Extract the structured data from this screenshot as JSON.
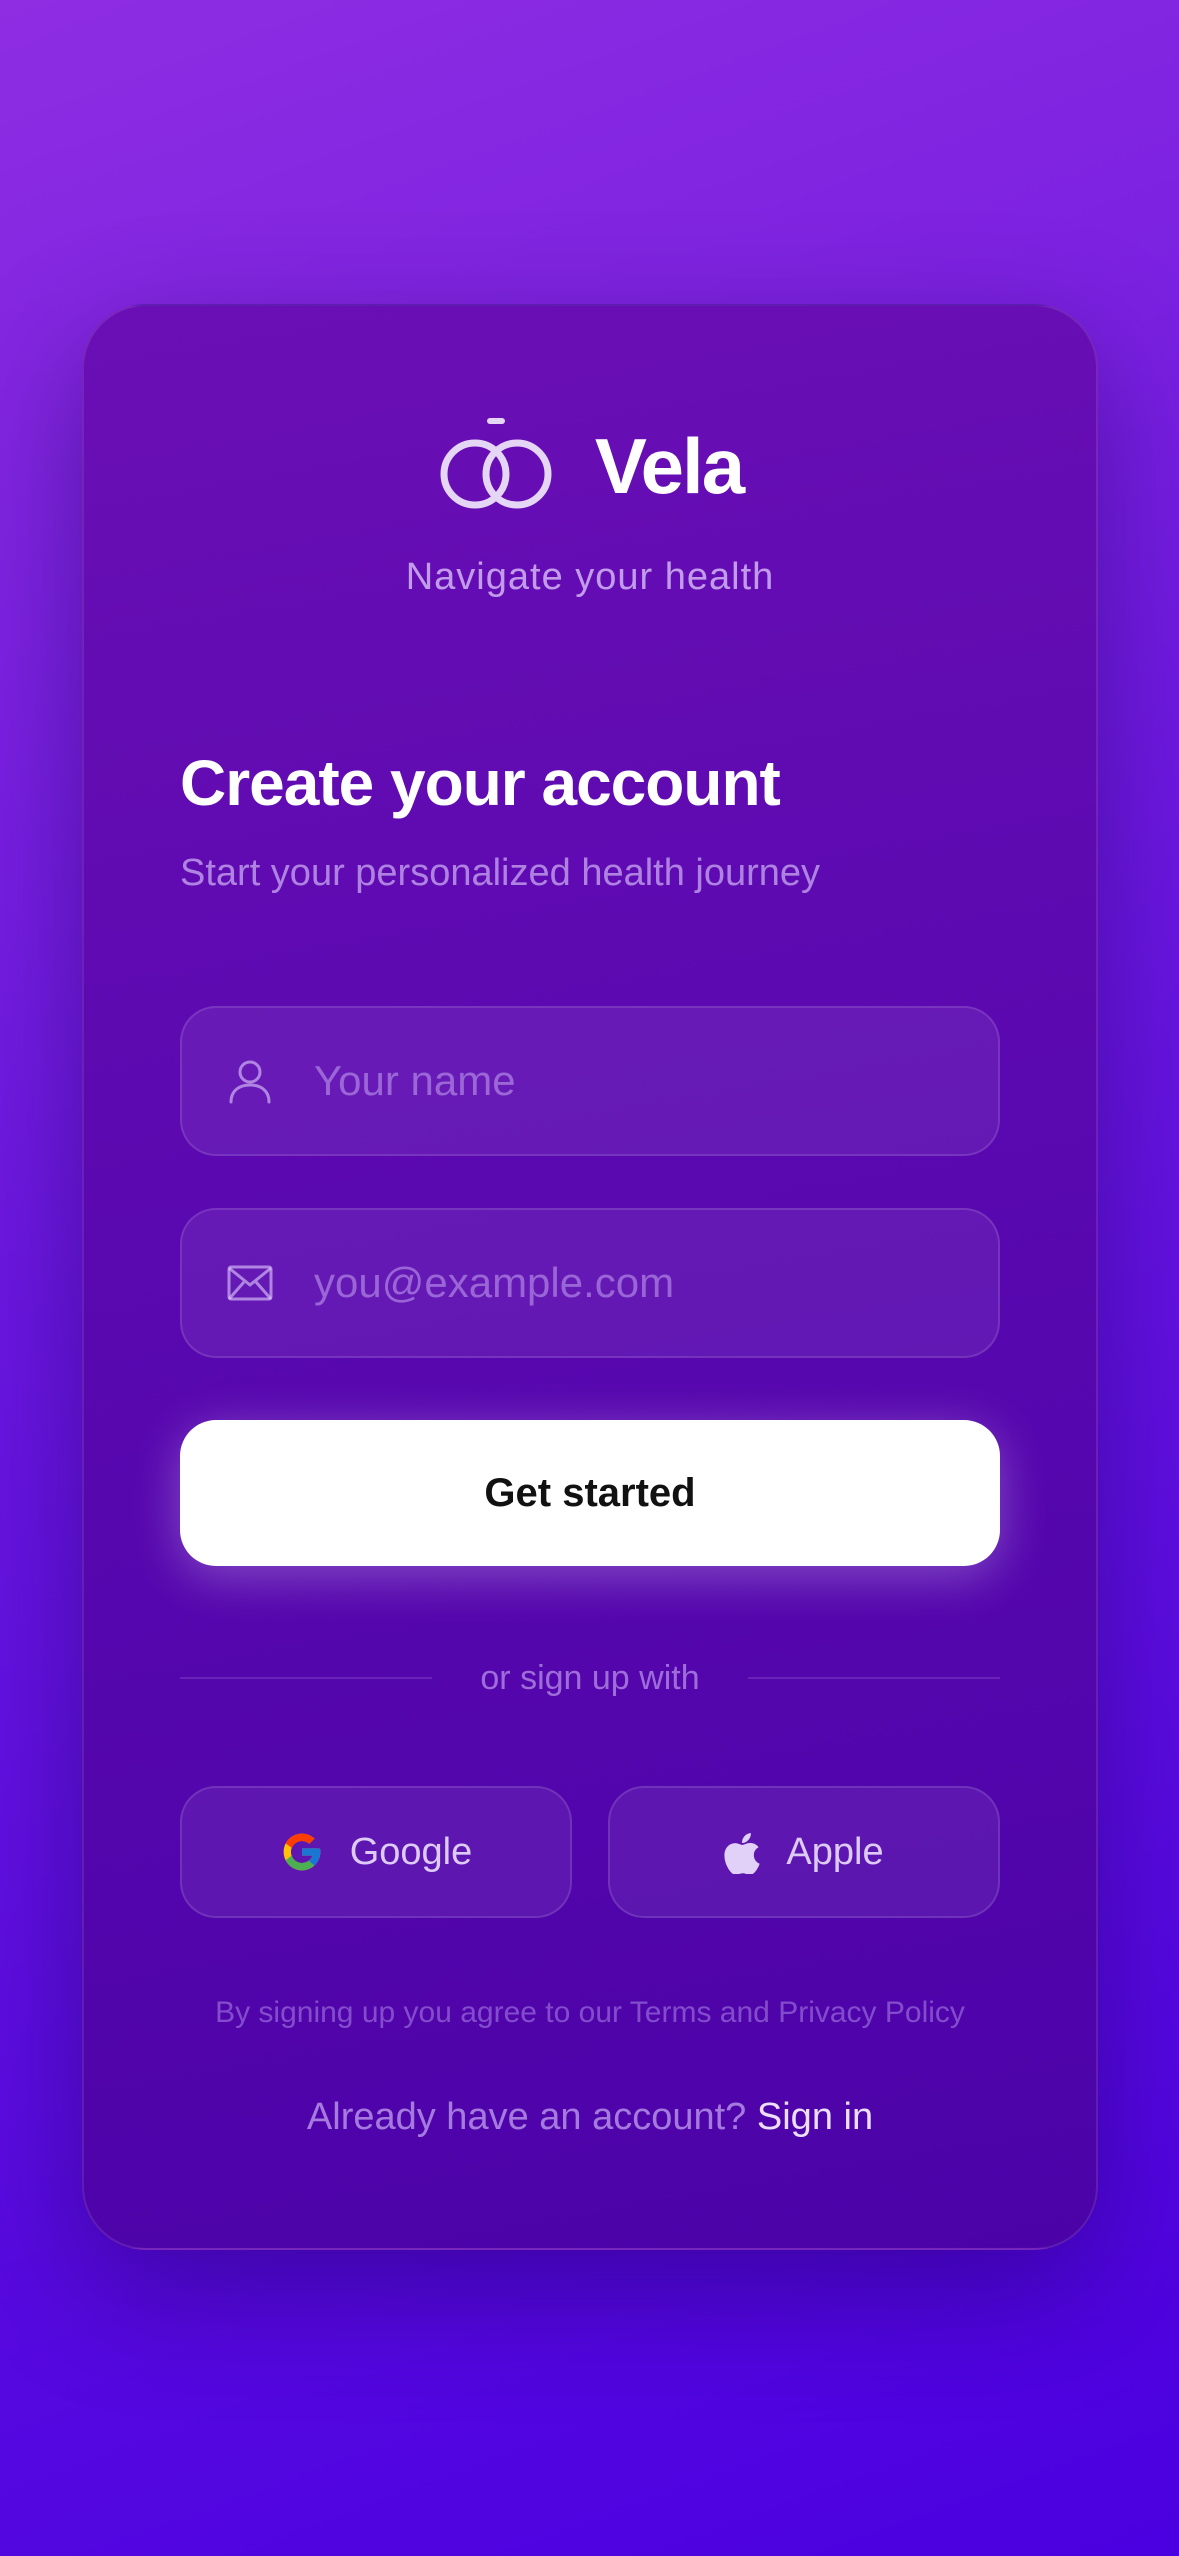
{
  "brand": {
    "name": "Vela",
    "tagline": "Navigate your health"
  },
  "form": {
    "title": "Create your account",
    "subtitle": "Start your personalized health journey",
    "name_field": {
      "placeholder": "Your name",
      "value": "",
      "icon": "user-icon"
    },
    "email_field": {
      "placeholder": "you@example.com",
      "value": "",
      "icon": "mail-icon"
    },
    "submit_label": "Get started"
  },
  "divider_text": "or sign up with",
  "social": {
    "google_label": "Google",
    "apple_label": "Apple"
  },
  "terms_text": "By signing up you agree to our Terms and Privacy Policy",
  "signin": {
    "prompt": "Already have an account?",
    "link": "Sign in"
  },
  "colors": {
    "background_top": "#8e2de2",
    "background_bottom": "#4a00e0",
    "card": "#5a08b0",
    "cta_background": "#ffffff"
  }
}
